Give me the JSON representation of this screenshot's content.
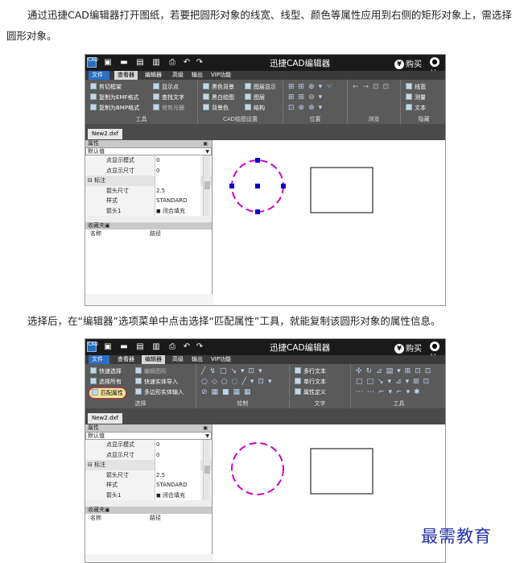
{
  "paragraph1": "通过迅捷CAD编辑器打开图纸，若要把圆形对象的线宽、线型、颜色等属性应用到右侧的矩形对象上，需选择圆形对象。",
  "paragraph2": "选择后，在“编辑器”选项菜单中点击选择“匹配属性”工具，就能复制该圆形对象的属性信息。",
  "app": {
    "title": "迅捷CAD编辑器",
    "buy": "购买",
    "login": "注",
    "logo": "CAD",
    "doc_tab": "New2.dxf"
  },
  "shot1": {
    "menu": [
      "文件",
      "查看器",
      "编辑器",
      "高级",
      "输出",
      "VIP功能"
    ],
    "groups": [
      {
        "label": "工具",
        "items": [
          "剪切框架",
          "复制为EMF格式",
          "复制为BMP格式",
          "显示点",
          "查找文字",
          "修剪光栅"
        ]
      },
      {
        "label": "CAD绘图设置",
        "items": [
          "黑色背景",
          "黑白绘图",
          "背景色",
          "图层显示",
          "图层",
          "结构"
        ]
      },
      {
        "label": "位置",
        "items": []
      },
      {
        "label": "浏览",
        "items": []
      },
      {
        "label": "隐藏",
        "items": [
          "线宽",
          "测量",
          "文本"
        ]
      }
    ]
  },
  "shot2": {
    "menu": [
      "文件",
      "查看器",
      "编辑器",
      "高级",
      "输出",
      "VIP功能"
    ],
    "groups": [
      {
        "label": "选择",
        "items": [
          "快速选择",
          "选择所有",
          "匹配属性",
          "编辑图形",
          "快速实体导入",
          "多边形实体输入"
        ]
      },
      {
        "label": "绘制",
        "items": []
      },
      {
        "label": "文字",
        "items": [
          "多行文本",
          "单行文本",
          "属性定义"
        ]
      },
      {
        "label": "工具",
        "items": []
      }
    ]
  },
  "props": {
    "header": "属性",
    "dropdown": "默认值",
    "rows": [
      {
        "k": "点显示模式",
        "v": "0"
      },
      {
        "k": "点显示尺寸",
        "v": "0"
      },
      {
        "k": "标注",
        "v": "",
        "cat": true
      },
      {
        "k": "箭头尺寸",
        "v": "2.5"
      },
      {
        "k": "样式",
        "v": "STANDARD"
      },
      {
        "k": "箭头1",
        "v": "闭合填充"
      }
    ]
  },
  "favorites": {
    "header": "收藏夹",
    "col_name": "名称",
    "col_path": "路径"
  },
  "watermark": "最需教育",
  "colors": {
    "circle": "#cc00cc",
    "grip": "#0000cc",
    "highlight": "#e03030"
  }
}
